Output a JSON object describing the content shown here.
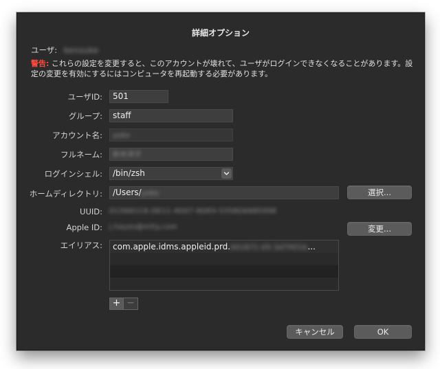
{
  "dialog": {
    "title": "詳細オプション",
    "user_label": "ユーザ:",
    "user_value": "kensuke",
    "warning_label": "警告:",
    "warning_text": "これらの設定を変更すると、このアカウントが壊れて、ユーザがログインできなくなることがあります。設定の変更を有効にするにはコンピュータを再起動する必要があります。"
  },
  "form": {
    "user_id_label": "ユーザID:",
    "user_id_value": "501",
    "group_label": "グループ:",
    "group_value": "staff",
    "account_name_label": "アカウント名:",
    "account_name_value": "yoko",
    "full_name_label": "フルネーム:",
    "full_name_value": "鈴木洋子",
    "shell_label": "ログインシェル:",
    "shell_value": "/bin/zsh",
    "home_label": "ホームディレクトリ:",
    "home_value_prefix": "/Users/",
    "home_value_blur": "yoko",
    "choose_button": "選択...",
    "uuid_label": "UUID:",
    "uuid_value": "D15681C8-DE11-4D07-8DE0-5358D6885998",
    "apple_id_label": "Apple ID:",
    "apple_id_value": "j.hayes@mlty.com",
    "change_button": "変更...",
    "aliases_label": "エイリアス:",
    "alias_prefix": "com.apple.idms.appleid.prd.",
    "alias_blur": "001871-05-3d7f0f1b",
    "alias_suffix": "...",
    "add_button": "+",
    "remove_button": "−"
  },
  "footer": {
    "cancel_button": "キャンセル",
    "ok_button": "OK"
  },
  "colors": {
    "window_bg": "#2b2b2b",
    "warning_red": "#ff4a3d",
    "field_bg": "#3e3e3e",
    "button_bg": "#5b5b5b"
  }
}
